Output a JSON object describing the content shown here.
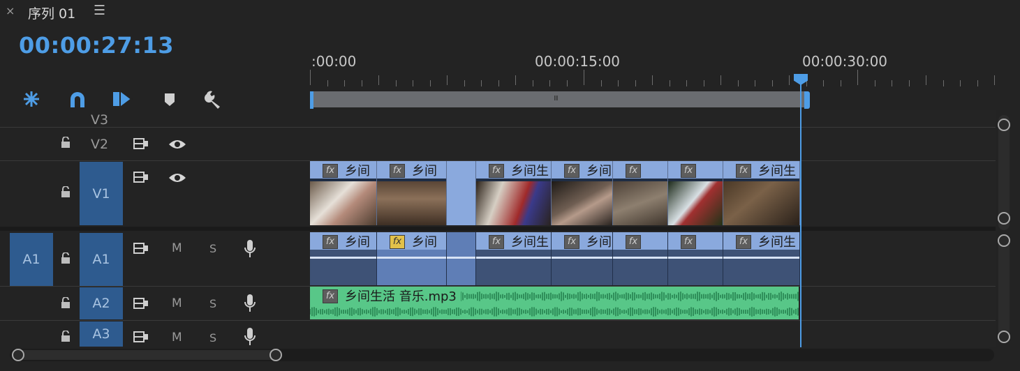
{
  "header": {
    "close": "×",
    "title": "序列 01",
    "menu": "☰"
  },
  "timecode": "00:00:27:13",
  "toolbar": {
    "tools": [
      {
        "name": "insert-nest-icon"
      },
      {
        "name": "snap-magnet-icon"
      },
      {
        "name": "linked-selection-icon"
      },
      {
        "name": "add-marker-icon"
      },
      {
        "name": "wrench-icon"
      }
    ]
  },
  "ruler": {
    "labels": [
      ":00:00",
      "00:00:15:00",
      "00:00:30:00"
    ],
    "playhead_time": "00:00:27:13",
    "workarea_handle": "III"
  },
  "tracks": {
    "video": [
      {
        "id": "V3",
        "label": "V3"
      },
      {
        "id": "V2",
        "label": "V2"
      },
      {
        "id": "V1",
        "label": "V1"
      }
    ],
    "audio": [
      {
        "id": "A1",
        "source_label": "A1",
        "label": "A1",
        "mute": "M",
        "solo": "S"
      },
      {
        "id": "A2",
        "label": "A2",
        "mute": "M",
        "solo": "S"
      },
      {
        "id": "A3",
        "label": "A3",
        "mute": "M",
        "solo": "S"
      }
    ]
  },
  "clips": {
    "fx": "fx",
    "video_names": [
      "乡间",
      "乡间",
      "",
      "乡间生",
      "乡间",
      "",
      "",
      "乡间生"
    ],
    "audio_names": [
      "乡间",
      "乡间",
      "",
      "乡间生",
      "乡间",
      "",
      "",
      "乡间生"
    ],
    "a2_name": "乡间生活 音乐.mp3"
  },
  "colors": {
    "timecode": "#4e9de6",
    "video_clip": "#8aa9dd",
    "audio_clip_a2": "#58c788",
    "track_target": "#2e5b8f"
  }
}
